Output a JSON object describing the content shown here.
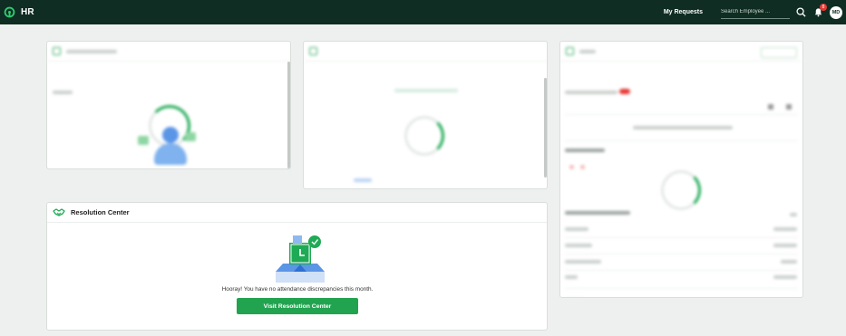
{
  "nav": {
    "brand": "HR",
    "my_requests": "My Requests",
    "search_placeholder": "Search Employee ...",
    "notification_count": "8",
    "avatar_initials": "MD",
    "colors": {
      "bar": "#0f2d22",
      "accent": "#1faa55"
    }
  },
  "resolution_center": {
    "title": "Resolution Center",
    "message": "Hooray! You have no attendance discrepancies this month.",
    "button_label": "Visit Resolution Center"
  },
  "icons": [
    "hr-logo-icon",
    "search-icon",
    "bell-icon",
    "handshake-icon",
    "calendar-icon",
    "clipboard-icon"
  ]
}
